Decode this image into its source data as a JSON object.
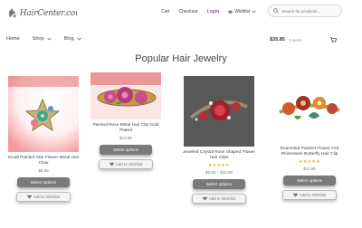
{
  "header": {
    "logo_text": "HairCenter.com",
    "links": [
      "Cart",
      "Checkout",
      "Login",
      "Wishlist"
    ],
    "search_placeholder": "Search for products..."
  },
  "nav": {
    "items": [
      "Home",
      "Shop",
      "Blog"
    ],
    "cart_amount": "$35.85",
    "cart_items": "3 items"
  },
  "page_title": "Popular Hair Jewelry",
  "buttons": {
    "select_options": "Select options",
    "add_to_wishlist": "Add to Wishlist"
  },
  "products": [
    {
      "name": "Small Painted Star Flower Metal Hair Claw",
      "stars": "",
      "price": "$8.95"
    },
    {
      "name": "Painted Rose Metal Hair Clip Gold Plated",
      "stars": "",
      "price": "$13.95"
    },
    {
      "name": "Jeweled Crystal Rose Shaped Flower Hair Clips",
      "stars": "★★★★★",
      "price": "$9.95 – $10.95"
    },
    {
      "name": "Enameled Painted Flower And Rhinestone Butterfly Hair Clip",
      "stars": "★★★★★",
      "price": "$11.95"
    }
  ],
  "colors": {
    "accent": "#96588a",
    "star": "#eeb012",
    "button": "#7a7a7a"
  },
  "icons": [
    "logo-icon",
    "search-icon",
    "heart-icon",
    "chevron-down-icon",
    "cart-icon"
  ]
}
